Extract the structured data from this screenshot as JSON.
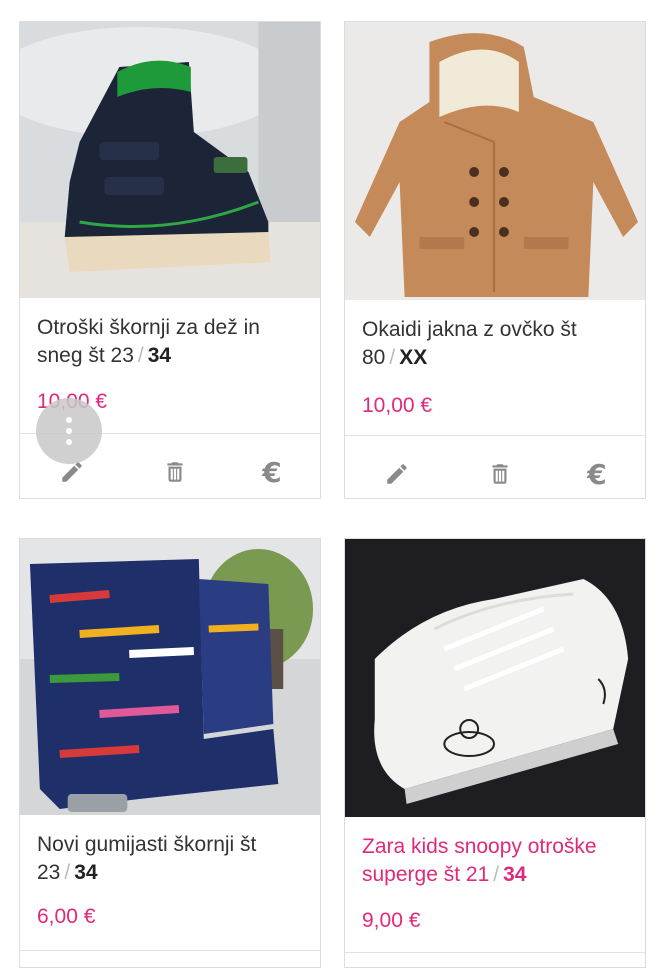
{
  "listings": [
    {
      "title": "Otroški škornji za dež in sneg št 23",
      "separator": "/",
      "size": "34",
      "price": "10,00 €"
    },
    {
      "title": "Okaidi jakna z ovčko št 80",
      "separator": "/",
      "size": "XX",
      "price": "10,00 €"
    },
    {
      "title": "Novi gumijasti škornji št 23",
      "separator": "/",
      "size": "34",
      "price": "6,00 €"
    },
    {
      "title": "Zara kids snoopy otroške superge št 21",
      "separator": "/",
      "size": "34",
      "price": "9,00 €"
    }
  ],
  "actions": {
    "edit_icon": "pencil-icon",
    "delete_icon": "trash-icon",
    "price_icon": "euro-icon",
    "euro_symbol": "€"
  },
  "fab": {
    "icon": "more-vertical-icon"
  },
  "colors": {
    "accent": "#e0297a",
    "icon": "#8a8a8a",
    "border": "#dcdcdc"
  }
}
